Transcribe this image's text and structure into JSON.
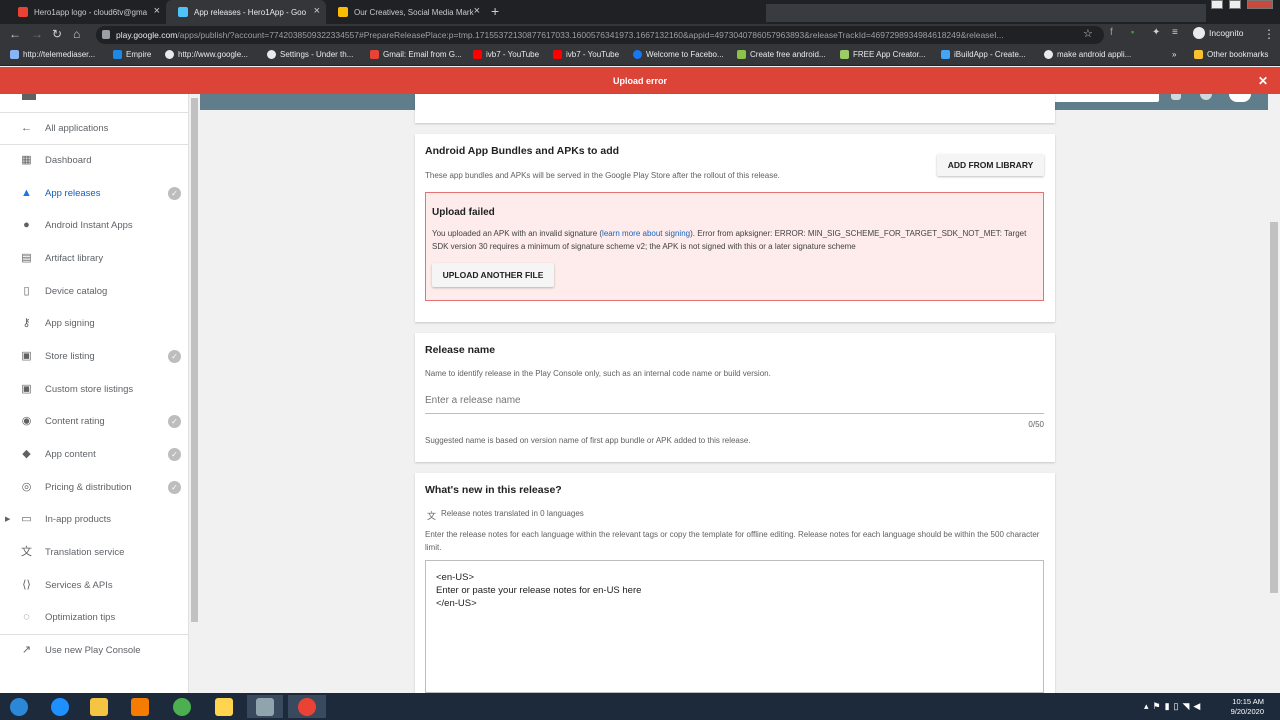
{
  "browser": {
    "tabs": [
      {
        "title": "Hero1app logo - cloud6tv@gma",
        "favicon_color": "#ea4335",
        "active": false
      },
      {
        "title": "App releases - Hero1App - Goo",
        "favicon_color": "#4fc3f7",
        "active": true
      },
      {
        "title": "Our Creatives, Social Media Mark",
        "favicon_color": "#fbbc04",
        "active": false
      }
    ],
    "url_host": "play.google.com",
    "url_rest": "/apps/publish/?account=7742038509322334557#PrepareReleasePlace:p=tmp.17155372130877617033.1600576341973.1667132160&appid=4973040786057963893&releaseTrackId=4697298934984618249&releaseI...",
    "incognito_label": "Incognito",
    "bookmarks": [
      {
        "label": "http://telemediaser...",
        "color": "#8ab4f8"
      },
      {
        "label": "Empire",
        "color": "#1e88e5"
      },
      {
        "label": "http://www.google...",
        "color": "#e8eaed"
      },
      {
        "label": "Settings - Under th...",
        "color": "#e8eaed"
      },
      {
        "label": "Gmail: Email from G...",
        "color": "#ea4335"
      },
      {
        "label": "ivb7 - YouTube",
        "color": "#ff0000"
      },
      {
        "label": "ivb7 - YouTube",
        "color": "#ff0000"
      },
      {
        "label": "Welcome to Facebo...",
        "color": "#1877f2"
      },
      {
        "label": "Create free android...",
        "color": "#8bc34a"
      },
      {
        "label": "FREE App Creator...",
        "color": "#9ccc65"
      },
      {
        "label": "iBuildApp - Create...",
        "color": "#42a5f5"
      },
      {
        "label": "make android appli...",
        "color": "#e8eaed"
      }
    ],
    "other_bookmarks": "Other bookmarks"
  },
  "banner": {
    "message": "Upload error",
    "color": "#db4437"
  },
  "sidebar": {
    "items": [
      {
        "label": "All applications",
        "icon": "arrow-back-icon",
        "glyph": "←",
        "checked": false,
        "active": false
      },
      {
        "label": "Dashboard",
        "icon": "dashboard-icon",
        "glyph": "▦",
        "checked": false,
        "active": false
      },
      {
        "label": "App releases",
        "icon": "rocket-icon",
        "glyph": "▲",
        "checked": true,
        "active": true
      },
      {
        "label": "Android Instant Apps",
        "icon": "instant-bolt-icon",
        "glyph": "●",
        "checked": false,
        "active": false
      },
      {
        "label": "Artifact library",
        "icon": "library-icon",
        "glyph": "▤",
        "checked": false,
        "active": false
      },
      {
        "label": "Device catalog",
        "icon": "device-icon",
        "glyph": "▯",
        "checked": false,
        "active": false
      },
      {
        "label": "App signing",
        "icon": "key-icon",
        "glyph": "⚷",
        "checked": false,
        "active": false
      },
      {
        "label": "Store listing",
        "icon": "store-icon",
        "glyph": "▣",
        "checked": true,
        "active": false
      },
      {
        "label": "Custom store listings",
        "icon": "custom-store-icon",
        "glyph": "▣",
        "checked": false,
        "active": false
      },
      {
        "label": "Content rating",
        "icon": "rating-icon",
        "glyph": "◉",
        "checked": true,
        "active": false
      },
      {
        "label": "App content",
        "icon": "shield-icon",
        "glyph": "◆",
        "checked": true,
        "active": false
      },
      {
        "label": "Pricing & distribution",
        "icon": "globe-icon",
        "glyph": "◎",
        "checked": true,
        "active": false
      },
      {
        "label": "In-app products",
        "icon": "credit-card-icon",
        "glyph": "▭",
        "checked": false,
        "active": false,
        "expandable": true
      },
      {
        "label": "Translation service",
        "icon": "translate-icon",
        "glyph": "文",
        "checked": false,
        "active": false
      },
      {
        "label": "Services & APIs",
        "icon": "api-icon",
        "glyph": "⟨⟩",
        "checked": false,
        "active": false
      },
      {
        "label": "Optimization tips",
        "icon": "lightbulb-icon",
        "glyph": "◌",
        "checked": false,
        "active": false
      },
      {
        "label": "Use new Play Console",
        "icon": "trend-icon",
        "glyph": "↗",
        "checked": false,
        "active": false
      }
    ]
  },
  "bundles_card": {
    "title": "Android App Bundles and APKs to add",
    "subtitle": "These app bundles and APKs will be served in the Google Play Store after the rollout of this release.",
    "add_button": "ADD FROM LIBRARY",
    "error_title": "Upload failed",
    "error_msg_before": "You uploaded an APK with an invalid signature (",
    "error_link": "learn more about signing",
    "error_msg_after": "). Error from apksigner: ERROR: MIN_SIG_SCHEME_FOR_TARGET_SDK_NOT_MET: Target SDK version 30 requires a minimum of signature scheme v2; the APK is not signed with this or a later signature scheme",
    "upload_button": "UPLOAD ANOTHER FILE"
  },
  "release_name_card": {
    "title": "Release name",
    "subtitle": "Name to identify release in the Play Console only, such as an internal code name or build version.",
    "placeholder": "Enter a release name",
    "counter": "0/50",
    "hint": "Suggested name is based on version name of first app bundle or APK added to this release."
  },
  "whats_new_card": {
    "title": "What's new in this release?",
    "translated": "Release notes translated in 0 languages",
    "instructions": "Enter the release notes for each language within the relevant tags or copy the template for offline editing. Release notes for each language should be within the 500 character limit.",
    "notes_lines": [
      "<en-US>",
      "Enter or paste your release notes for en-US here",
      "</en-US>"
    ]
  },
  "taskbar": {
    "time": "10:15 AM",
    "date": "9/20/2020",
    "apps": [
      {
        "name": "start",
        "color": "#2b88d8"
      },
      {
        "name": "internet-explorer",
        "color": "#1e90ff"
      },
      {
        "name": "file-explorer",
        "color": "#f4c542"
      },
      {
        "name": "media-player",
        "color": "#f57c00"
      },
      {
        "name": "chrome",
        "color": "#4caf50"
      },
      {
        "name": "folder",
        "color": "#ffd54f"
      },
      {
        "name": "app-window",
        "color": "#90a4ae"
      },
      {
        "name": "chrome-active",
        "color": "#ea4335"
      }
    ]
  }
}
